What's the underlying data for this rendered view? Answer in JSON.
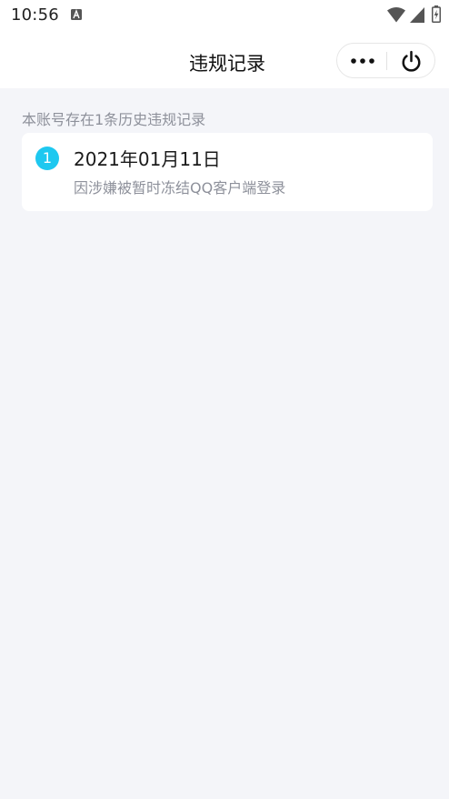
{
  "status_bar": {
    "time": "10:56",
    "notification_icon": "text-a-icon",
    "wifi_icon": "wifi-icon",
    "signal_icon": "cellular-signal-icon",
    "battery_icon": "battery-icon"
  },
  "nav": {
    "title": "违规记录",
    "more_icon": "more-dots-icon",
    "power_icon": "power-icon"
  },
  "summary": "本账号存在1条历史违规记录",
  "records": [
    {
      "index": "1",
      "date": "2021年01月11日",
      "reason": "因涉嫌被暂时冻结QQ客户端登录"
    }
  ],
  "colors": {
    "page_background": "#f4f5f9",
    "index_badge": "#1ec8f0",
    "secondary_text": "#8e919b"
  }
}
